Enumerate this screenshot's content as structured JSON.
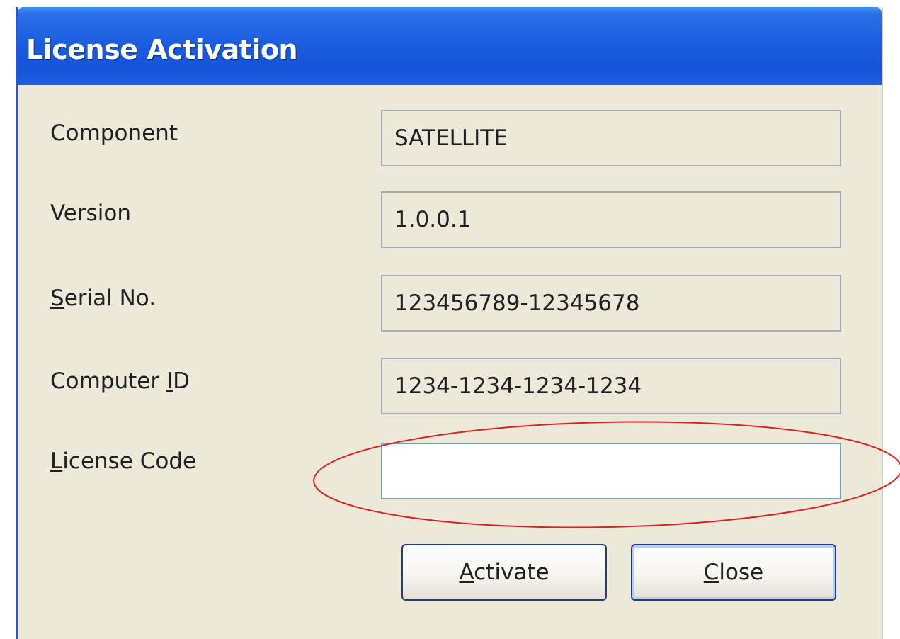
{
  "window": {
    "title": "License Activation"
  },
  "fields": {
    "component": {
      "label": "Component",
      "value": "SATELLITE"
    },
    "version": {
      "label": "Version",
      "value": "1.0.0.1"
    },
    "serial": {
      "label_mnemonic": "S",
      "label_rest": "erial No.",
      "value": "123456789-12345678"
    },
    "computer_id": {
      "label_prefix": "Computer ",
      "label_mnemonic": "I",
      "label_rest": "D",
      "value": "1234-1234-1234-1234"
    },
    "license_code": {
      "label_mnemonic": "L",
      "label_rest": "icense Code",
      "value": ""
    }
  },
  "buttons": {
    "activate": {
      "mnemonic": "A",
      "rest": "ctivate"
    },
    "close": {
      "mnemonic": "C",
      "rest": "lose"
    }
  },
  "colors": {
    "titlebar": "#1c5ee0",
    "dialog_bg": "#ece9d8",
    "annotation": "#e02020"
  }
}
